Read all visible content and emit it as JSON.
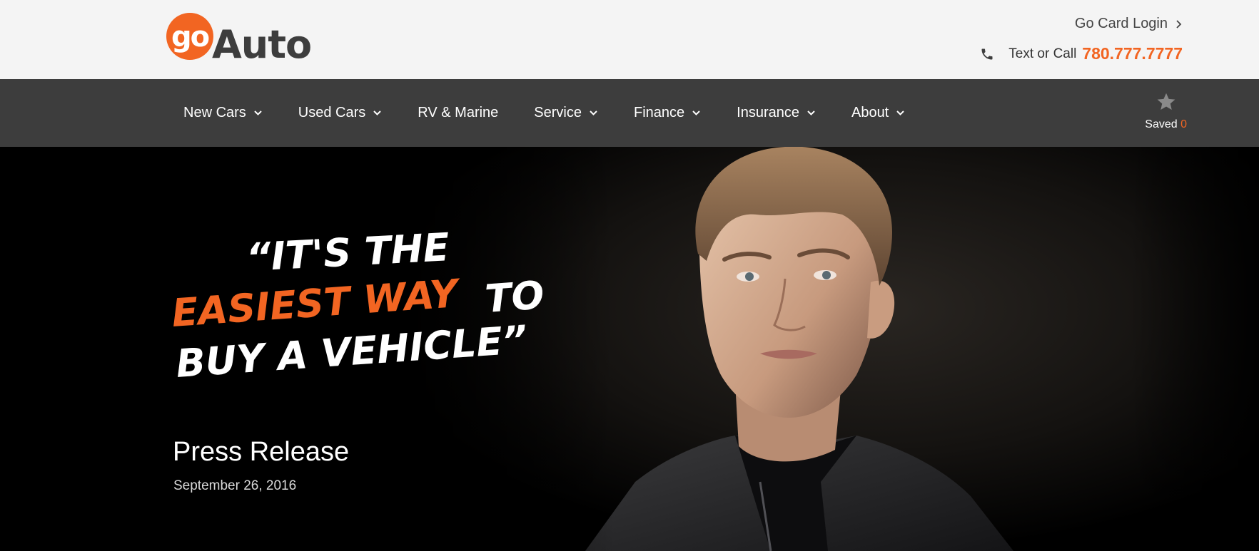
{
  "header": {
    "logo": {
      "part1": "go",
      "part2": "Auto",
      "brand_color": "#f26522",
      "text_color": "#3d3d3d"
    },
    "card_login": "Go Card Login",
    "contact_label": "Text or Call",
    "phone": "780.777.7777"
  },
  "nav": {
    "items": [
      {
        "label": "New Cars",
        "has_dropdown": true
      },
      {
        "label": "Used Cars",
        "has_dropdown": true
      },
      {
        "label": "RV & Marine",
        "has_dropdown": false
      },
      {
        "label": "Service",
        "has_dropdown": true
      },
      {
        "label": "Finance",
        "has_dropdown": true
      },
      {
        "label": "Insurance",
        "has_dropdown": true
      },
      {
        "label": "About",
        "has_dropdown": true
      }
    ],
    "saved_label": "Saved",
    "saved_count": "0"
  },
  "hero": {
    "slogan": {
      "line1": "“IT'S THE",
      "line2_highlight": "EASIEST WAY",
      "line2_rest": "TO",
      "line3": "BUY A VEHICLE”",
      "highlight_color": "#f26522"
    },
    "title": "Press Release",
    "date": "September 26, 2016"
  },
  "icons": {
    "card_login": "chevron-right-icon",
    "contact": "phone-icon",
    "dropdown": "chevron-down-icon",
    "saved": "star-icon"
  },
  "colors": {
    "accent": "#f26522",
    "topbar_bg": "#f4f4f4",
    "nav_bg": "#3d3d3d",
    "hero_bg": "#000000"
  }
}
